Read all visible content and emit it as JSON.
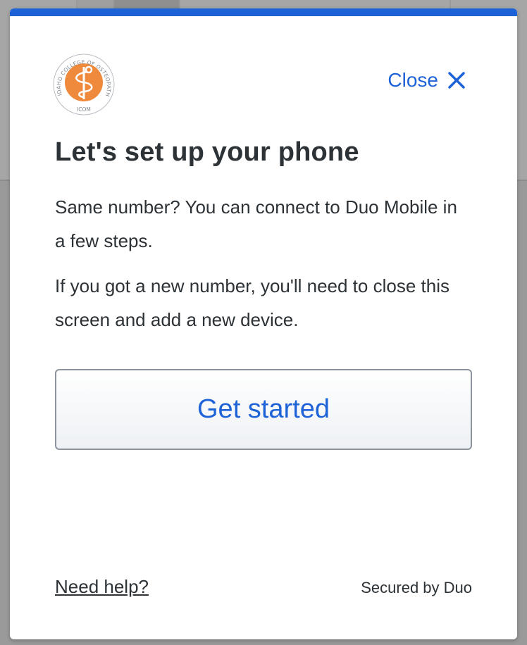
{
  "logo": {
    "ring_text": "IDAHO COLLEGE OF OSTEOPATHIC MEDICINE",
    "initials": "ICOM",
    "ring_color": "#9aa3ab",
    "fill_color": "#ef8a3c"
  },
  "header": {
    "close_label": "Close"
  },
  "main": {
    "title": "Let's set up your phone",
    "paragraph1": "Same number? You can connect to Duo Mobile in a few steps.",
    "paragraph2": "If you got a new number, you'll need to close this screen and add a new device.",
    "get_started_label": "Get started"
  },
  "footer": {
    "help_label": "Need help?",
    "secured_label": "Secured by Duo"
  },
  "colors": {
    "accent": "#1e62d8",
    "text": "#2c3236",
    "button_border": "#8b939c"
  },
  "icons": {
    "close": "close-icon",
    "logo": "icom-logo"
  }
}
